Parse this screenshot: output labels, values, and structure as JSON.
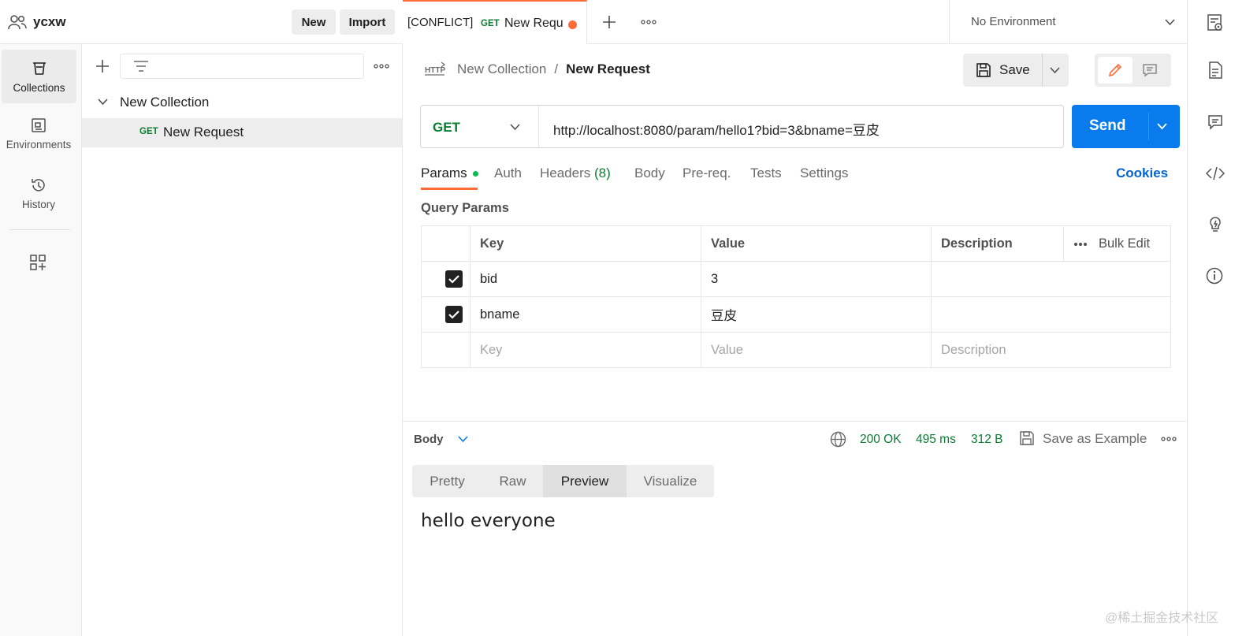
{
  "workspace": {
    "name": "ycxw",
    "new_label": "New",
    "import_label": "Import"
  },
  "rail": [
    {
      "label": "Collections",
      "icon": "collections-icon"
    },
    {
      "label": "Environments",
      "icon": "environments-icon"
    },
    {
      "label": "History",
      "icon": "history-icon"
    },
    {
      "label": "",
      "icon": "add-workspace-icon"
    }
  ],
  "sidebar": {
    "collection_name": "New Collection",
    "request": {
      "method": "GET",
      "name": "New Request"
    }
  },
  "tab": {
    "prefix": "[CONFLICT]",
    "method": "GET",
    "name": "New Requ"
  },
  "environment": {
    "selected": "No Environment"
  },
  "breadcrumb": {
    "collection": "New Collection",
    "separator": "/",
    "request": "New Request"
  },
  "toolbar": {
    "save_label": "Save"
  },
  "request": {
    "method": "GET",
    "url": "http://localhost:8080/param/hello1?bid=3&bname=豆皮",
    "send_label": "Send"
  },
  "request_tabs": {
    "params": "Params",
    "auth": "Auth",
    "headers": "Headers",
    "headers_count": "(8)",
    "body": "Body",
    "prereq": "Pre-req.",
    "tests": "Tests",
    "settings": "Settings",
    "cookies": "Cookies"
  },
  "query_params": {
    "title": "Query Params",
    "headers": {
      "key": "Key",
      "value": "Value",
      "description": "Description",
      "bulk_edit": "Bulk Edit"
    },
    "rows": [
      {
        "checked": true,
        "key": "bid",
        "value": "3",
        "description": ""
      },
      {
        "checked": true,
        "key": "bname",
        "value": "豆皮",
        "description": ""
      }
    ],
    "placeholder": {
      "key": "Key",
      "value": "Value",
      "description": "Description"
    }
  },
  "response": {
    "body_label": "Body",
    "status": "200 OK",
    "time": "495 ms",
    "size": "312 B",
    "save_example": "Save as Example",
    "view_tabs": [
      "Pretty",
      "Raw",
      "Preview",
      "Visualize"
    ],
    "active_view": "Preview",
    "content": "hello everyone"
  },
  "watermark": "@稀土掘金技术社区",
  "colors": {
    "accent_orange": "#ff6c37",
    "send_blue": "#097bed",
    "get_green": "#0a7d32",
    "cookies_blue": "#0265d2"
  }
}
